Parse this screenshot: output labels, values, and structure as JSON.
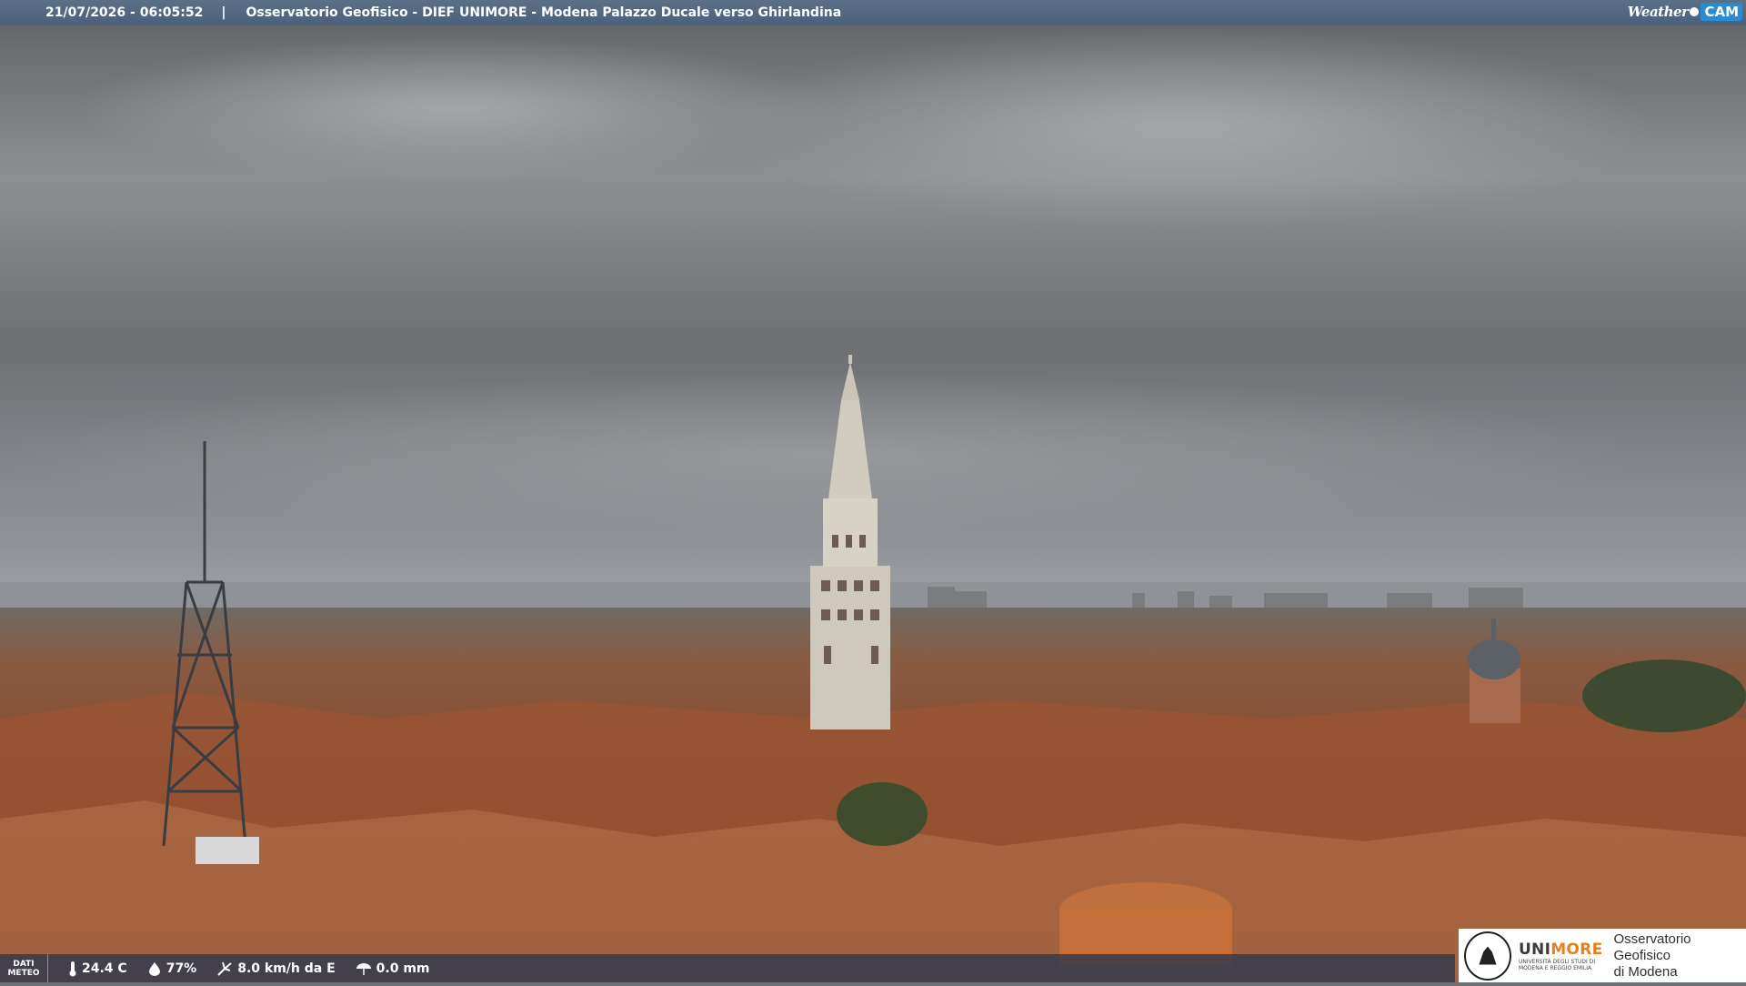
{
  "header": {
    "timestamp": "21/07/2026 - 06:05:52",
    "separator": "|",
    "title": "Osservatorio Geofisico - DIEF UNIMORE - Modena Palazzo Ducale verso Ghirlandina",
    "logo_weather": "Weather",
    "logo_cam": "CAM"
  },
  "weather": {
    "label_line1": "DATI",
    "label_line2": "METEO",
    "temperature": "24.4 C",
    "humidity": "77%",
    "wind": "8.0 km/h da E",
    "rain": "0.0 mm",
    "icons": [
      "thermometer-icon",
      "humidity-drop-icon",
      "wind-icon",
      "rain-icon"
    ]
  },
  "logo": {
    "uni_prefix": "UNI",
    "uni_suffix": "MORE",
    "uni_sub1": "UNIVERSITÀ DEGLI STUDI DI",
    "uni_sub2": "MODENA E REGGIO EMILIA",
    "obs_line1": "Osservatorio Geofisico",
    "obs_line2": "di Modena"
  },
  "colors": {
    "sky": "#8a8d91",
    "roofs": "#8c4a2e",
    "bar": "#4d6079",
    "accent_orange": "#e4801e"
  }
}
